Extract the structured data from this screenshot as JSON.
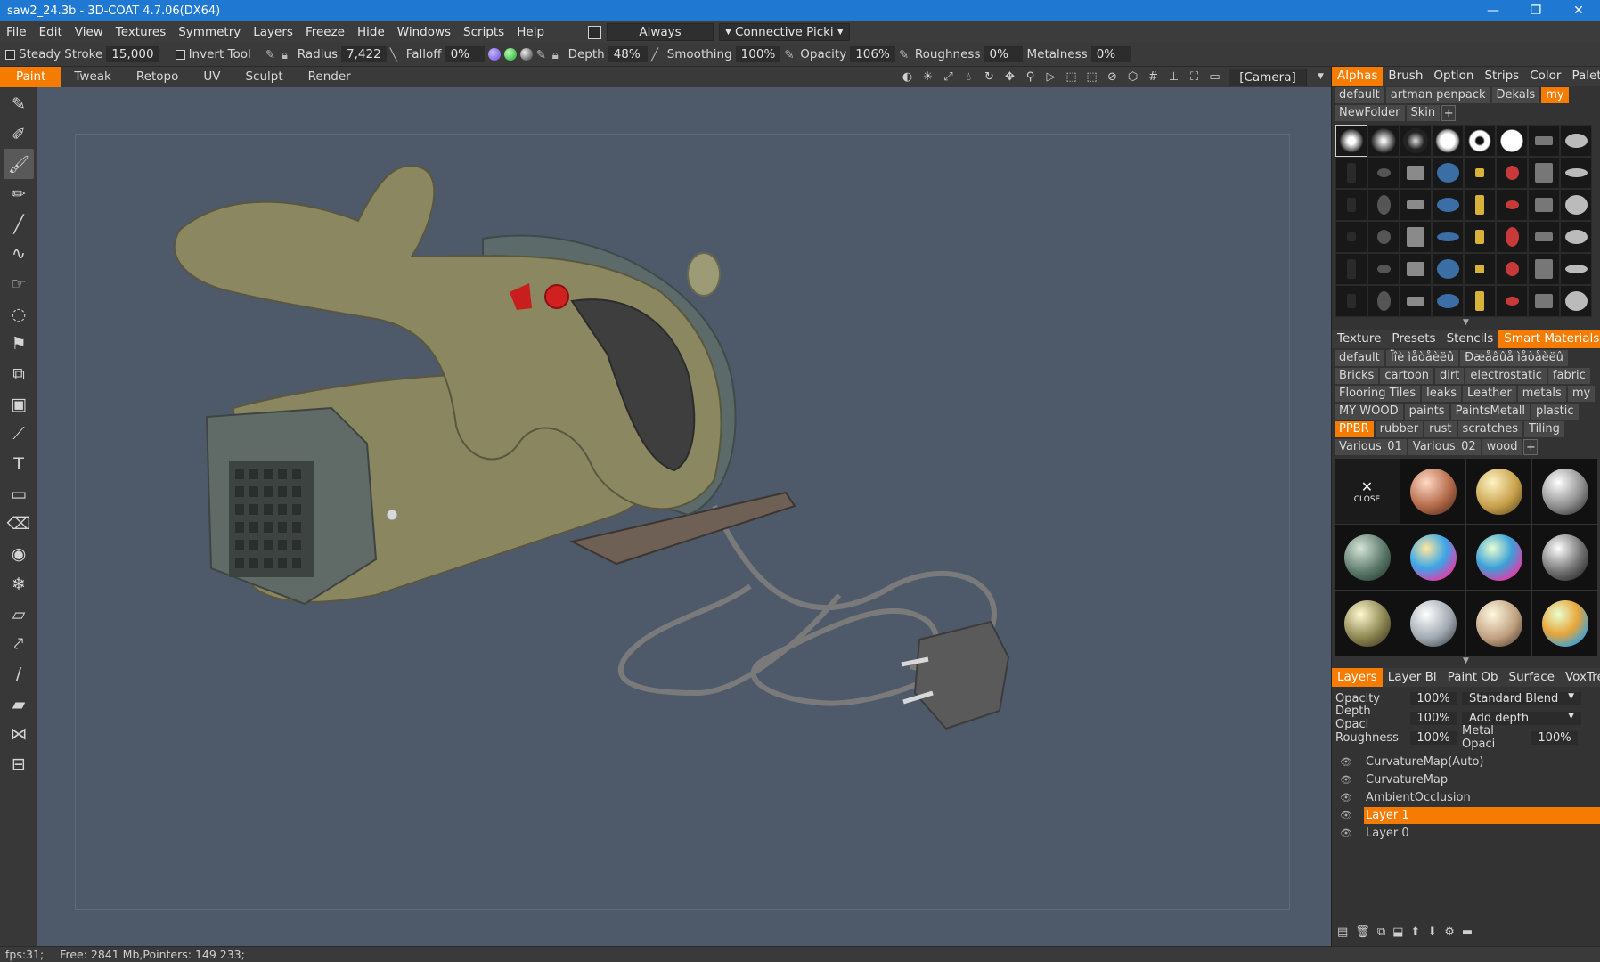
{
  "window": {
    "title": "saw2_24.3b - 3D-COAT 4.7.06(DX64)",
    "minimize": "—",
    "maximize": "❐",
    "close": "✕"
  },
  "menu": {
    "items": [
      "File",
      "Edit",
      "View",
      "Textures",
      "Symmetry",
      "Layers",
      "Freeze",
      "Hide",
      "Windows",
      "Scripts",
      "Help"
    ],
    "always_label": "Always",
    "connective_label": "Connective Picki"
  },
  "params": {
    "steady_label": "Steady Stroke",
    "steady_value": "15,000",
    "invert_label": "Invert Tool",
    "radius_label": "Radius",
    "radius_value": "7,422",
    "falloff_label": "Falloff",
    "falloff_value": "0%",
    "depth_label": "Depth",
    "depth_value": "48%",
    "smoothing_label": "Smoothing",
    "smoothing_value": "100%",
    "opacity_label": "Opacity",
    "opacity_value": "106%",
    "roughness_label": "Roughness",
    "roughness_value": "0%",
    "metalness_label": "Metalness",
    "metalness_value": "0%"
  },
  "rooms": {
    "items": [
      "Paint",
      "Tweak",
      "Retopo",
      "UV",
      "Sculpt",
      "Render"
    ],
    "active": "Paint",
    "camera": "[Camera]"
  },
  "left_tools": [
    "brush-icon",
    "airbrush-icon",
    "paint-brush-icon",
    "pencil-icon",
    "line-icon",
    "spline-icon",
    "smudge-icon",
    "blur-icon",
    "stamp-icon",
    "clone-icon",
    "copy-icon",
    "path-icon",
    "text-icon",
    "rect-icon",
    "eraser-icon",
    "eye-icon",
    "freeze-icon",
    "ruler-icon",
    "pipette-icon",
    "knife-icon",
    "fill-icon",
    "butterfly-icon",
    "measure-icon"
  ],
  "alphas": {
    "tabs": [
      "Alphas",
      "Brush",
      "Option",
      "Strips",
      "Color",
      "Palette"
    ],
    "active_tab": "Alphas",
    "folders": [
      "default",
      "artman penpack",
      "Dekals",
      "my",
      "NewFolder",
      "Skin"
    ],
    "active_folder": "my"
  },
  "materials": {
    "tabs": [
      "Texture",
      "Presets",
      "Stencils",
      "Smart Materials"
    ],
    "active_tab": "Smart Materials",
    "folders": [
      "default",
      "Ïîè ìåòåèëû",
      "Ðæåâûå ìåòåèëû",
      "Bricks",
      "cartoon",
      "dirt",
      "electrostatic",
      "fabric",
      "Flooring Tiles",
      "leaks",
      "Leather",
      "metals",
      "my",
      "MY WOOD",
      "paints",
      "PaintsMetall",
      "plastic",
      "PPBR",
      "rubber",
      "rust",
      "scratches",
      "Tiling",
      "Various_01",
      "Various_02",
      "wood"
    ],
    "active_folder": "PPBR",
    "close_label": "CLOSE"
  },
  "layers": {
    "tabs": [
      "Layers",
      "Layer Bl",
      "Paint Ob",
      "Surface",
      "VoxTree"
    ],
    "active_tab": "Layers",
    "opacity_label": "Opacity",
    "opacity_value": "100%",
    "blend_mode": "Standard Blend",
    "depth_opacity_label": "Depth Opaci",
    "depth_opacity_value": "100%",
    "add_depth": "Add depth",
    "roughness_label": "Roughness",
    "roughness_value": "100%",
    "metal_opacity_label": "Metal Opaci",
    "metal_opacity_value": "100%",
    "items": [
      "CurvatureMap(Auto)",
      "CurvatureMap",
      "AmbientOcclusion",
      "Layer 1",
      "Layer 0"
    ],
    "active": "Layer 1"
  },
  "status": {
    "fps": "fps:31;",
    "memory": "Free: 2841 Mb,Pointers: 149 233;"
  },
  "colors": {
    "accent": "#f57c00",
    "title_bar": "#1f78d1",
    "viewport_bg": "#4e5a6a",
    "saw_body": "#8a8660"
  }
}
